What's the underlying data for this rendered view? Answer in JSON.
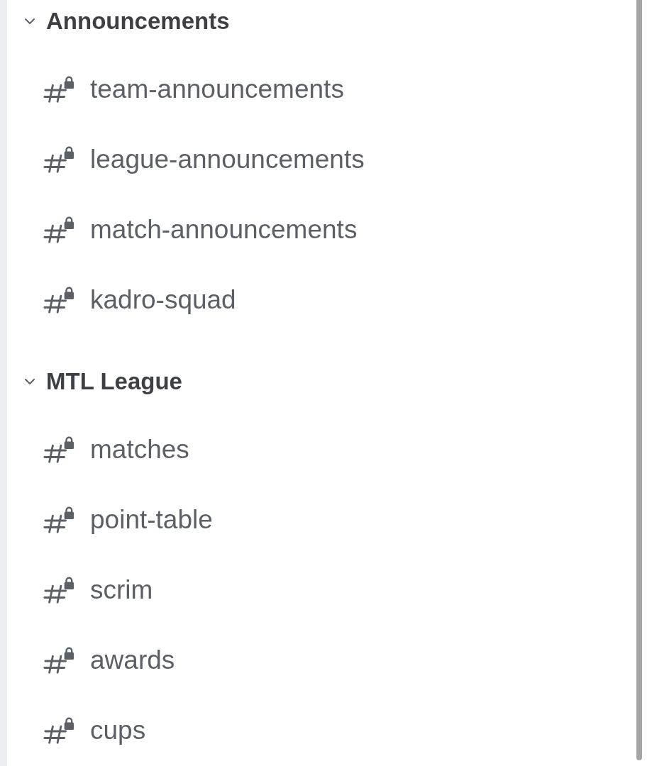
{
  "categories": [
    {
      "name": "Announcements",
      "expanded": true,
      "channels": [
        {
          "name": "team-announcements",
          "locked": true
        },
        {
          "name": "league-announcements",
          "locked": true
        },
        {
          "name": "match-announcements",
          "locked": true
        },
        {
          "name": "kadro-squad",
          "locked": true
        }
      ]
    },
    {
      "name": "MTL League",
      "expanded": true,
      "channels": [
        {
          "name": "matches",
          "locked": true
        },
        {
          "name": "point-table",
          "locked": true
        },
        {
          "name": "scrim",
          "locked": true
        },
        {
          "name": "awards",
          "locked": true
        },
        {
          "name": "cups",
          "locked": true
        }
      ]
    }
  ]
}
